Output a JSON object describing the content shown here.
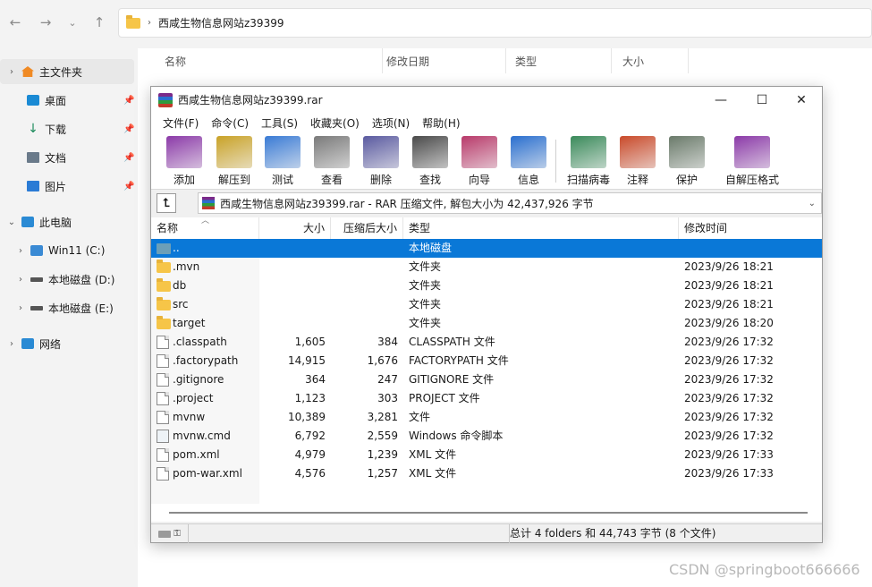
{
  "explorer": {
    "breadcrumb": "西咸生物信息网站z39399",
    "sidebar": {
      "home": "主文件夹",
      "quick": [
        {
          "label": "桌面",
          "icon": "desktop-icon"
        },
        {
          "label": "下载",
          "icon": "download-icon"
        },
        {
          "label": "文档",
          "icon": "document-icon"
        },
        {
          "label": "图片",
          "icon": "picture-icon"
        }
      ],
      "this_pc": "此电脑",
      "drives": [
        "Win11 (C:)",
        "本地磁盘 (D:)",
        "本地磁盘 (E:)"
      ],
      "network": "网络"
    },
    "columns": [
      "名称",
      "修改日期",
      "类型",
      "大小"
    ]
  },
  "rar": {
    "title": "西咸生物信息网站z39399.rar",
    "menu": [
      "文件(F)",
      "命令(C)",
      "工具(S)",
      "收藏夹(O)",
      "选项(N)",
      "帮助(H)"
    ],
    "toolbar": [
      {
        "label": "添加",
        "icon": "add-archive-icon",
        "color": "#8b3aa8"
      },
      {
        "label": "解压到",
        "icon": "extract-to-icon",
        "color": "#c9a227"
      },
      {
        "label": "测试",
        "icon": "test-icon",
        "color": "#3a7bd5"
      },
      {
        "label": "查看",
        "icon": "view-icon",
        "color": "#7a7a7a"
      },
      {
        "label": "删除",
        "icon": "delete-icon",
        "color": "#5a5aa0"
      },
      {
        "label": "查找",
        "icon": "find-icon",
        "color": "#4a4a4a"
      },
      {
        "label": "向导",
        "icon": "wizard-icon",
        "color": "#b83a6a"
      },
      {
        "label": "信息",
        "icon": "info-icon",
        "color": "#2a6fcf"
      },
      {
        "label": "扫描病毒",
        "icon": "virus-scan-icon",
        "color": "#3a8a5a"
      },
      {
        "label": "注释",
        "icon": "comment-icon",
        "color": "#c94a2a"
      },
      {
        "label": "保护",
        "icon": "protect-icon",
        "color": "#6a7a6a"
      },
      {
        "label": "自解压格式",
        "icon": "sfx-icon",
        "color": "#8b3aa8"
      }
    ],
    "path": "西咸生物信息网站z39399.rar - RAR 压缩文件, 解包大小为 42,437,926 字节",
    "columns": {
      "name": "名称",
      "size": "大小",
      "packed": "压缩后大小",
      "type": "类型",
      "modified": "修改时间"
    },
    "files": [
      {
        "name": "..",
        "size": "",
        "packed": "",
        "type": "本地磁盘",
        "modified": "",
        "kind": "updir"
      },
      {
        "name": ".mvn",
        "size": "",
        "packed": "",
        "type": "文件夹",
        "modified": "2023/9/26 18:21",
        "kind": "folder"
      },
      {
        "name": "db",
        "size": "",
        "packed": "",
        "type": "文件夹",
        "modified": "2023/9/26 18:21",
        "kind": "folder"
      },
      {
        "name": "src",
        "size": "",
        "packed": "",
        "type": "文件夹",
        "modified": "2023/9/26 18:21",
        "kind": "folder"
      },
      {
        "name": "target",
        "size": "",
        "packed": "",
        "type": "文件夹",
        "modified": "2023/9/26 18:20",
        "kind": "folder"
      },
      {
        "name": ".classpath",
        "size": "1,605",
        "packed": "384",
        "type": "CLASSPATH 文件",
        "modified": "2023/9/26 17:32",
        "kind": "file"
      },
      {
        "name": ".factorypath",
        "size": "14,915",
        "packed": "1,676",
        "type": "FACTORYPATH 文件",
        "modified": "2023/9/26 17:32",
        "kind": "file"
      },
      {
        "name": ".gitignore",
        "size": "364",
        "packed": "247",
        "type": "GITIGNORE 文件",
        "modified": "2023/9/26 17:32",
        "kind": "file"
      },
      {
        "name": ".project",
        "size": "1,123",
        "packed": "303",
        "type": "PROJECT 文件",
        "modified": "2023/9/26 17:32",
        "kind": "file"
      },
      {
        "name": "mvnw",
        "size": "10,389",
        "packed": "3,281",
        "type": "文件",
        "modified": "2023/9/26 17:32",
        "kind": "file"
      },
      {
        "name": "mvnw.cmd",
        "size": "6,792",
        "packed": "2,559",
        "type": "Windows 命令脚本",
        "modified": "2023/9/26 17:32",
        "kind": "cmd"
      },
      {
        "name": "pom.xml",
        "size": "4,979",
        "packed": "1,239",
        "type": "XML 文件",
        "modified": "2023/9/26 17:33",
        "kind": "file"
      },
      {
        "name": "pom-war.xml",
        "size": "4,576",
        "packed": "1,257",
        "type": "XML 文件",
        "modified": "2023/9/26 17:33",
        "kind": "file"
      }
    ],
    "status": "总计 4 folders 和 44,743 字节 (8 个文件)"
  },
  "watermark": "CSDN @springboot666666",
  "colors": {
    "selection": "#0a78d7",
    "folder": "#f6c548"
  }
}
